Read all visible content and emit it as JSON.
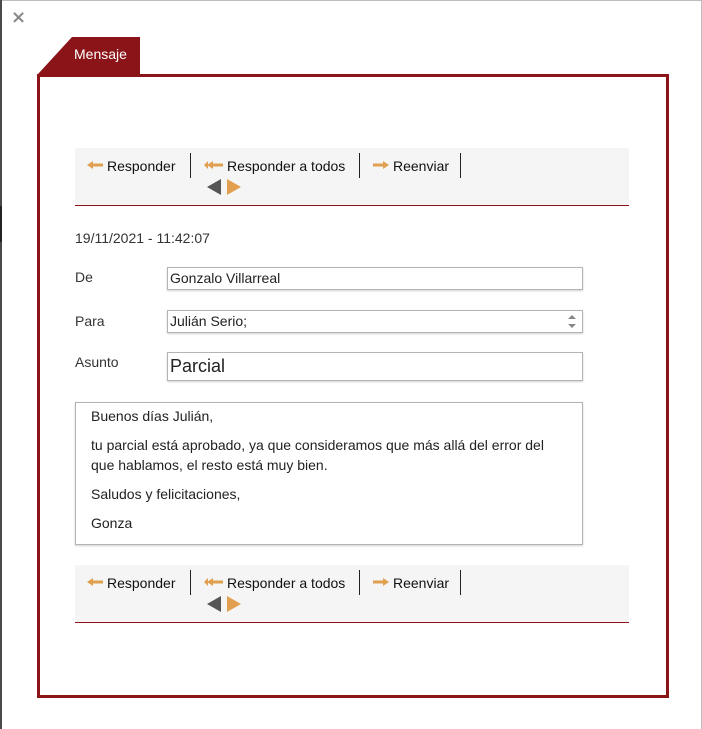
{
  "dialog": {
    "close_glyph": "×"
  },
  "tab": {
    "label": "Mensaje"
  },
  "toolbar": {
    "reply": "Responder",
    "reply_all": "Responder a todos",
    "forward": "Reenviar",
    "reply_icon": "reply-arrow-icon",
    "forward_icon": "forward-arrow-icon",
    "prev_icon": "prev-triangle-icon",
    "next_icon": "next-triangle-icon"
  },
  "message": {
    "timestamp": "19/11/2021 - 11:42:07",
    "from_label": "De",
    "from_value": "Gonzalo Villarreal",
    "to_label": "Para",
    "to_value": "Julián Serio;",
    "subject_label": "Asunto",
    "subject_value": "Parcial",
    "body": [
      "Buenos días Julián,",
      "tu parcial está aprobado, ya que consideramos que más allá del error del que hablamos, el resto está muy bien.",
      "Saludos y felicitaciones,",
      "Gonza"
    ]
  },
  "colors": {
    "accent": "#8b1418",
    "icon_orange": "#e0a050",
    "toolbar_bg": "#f5f5f5",
    "nav_gray": "#555555"
  }
}
